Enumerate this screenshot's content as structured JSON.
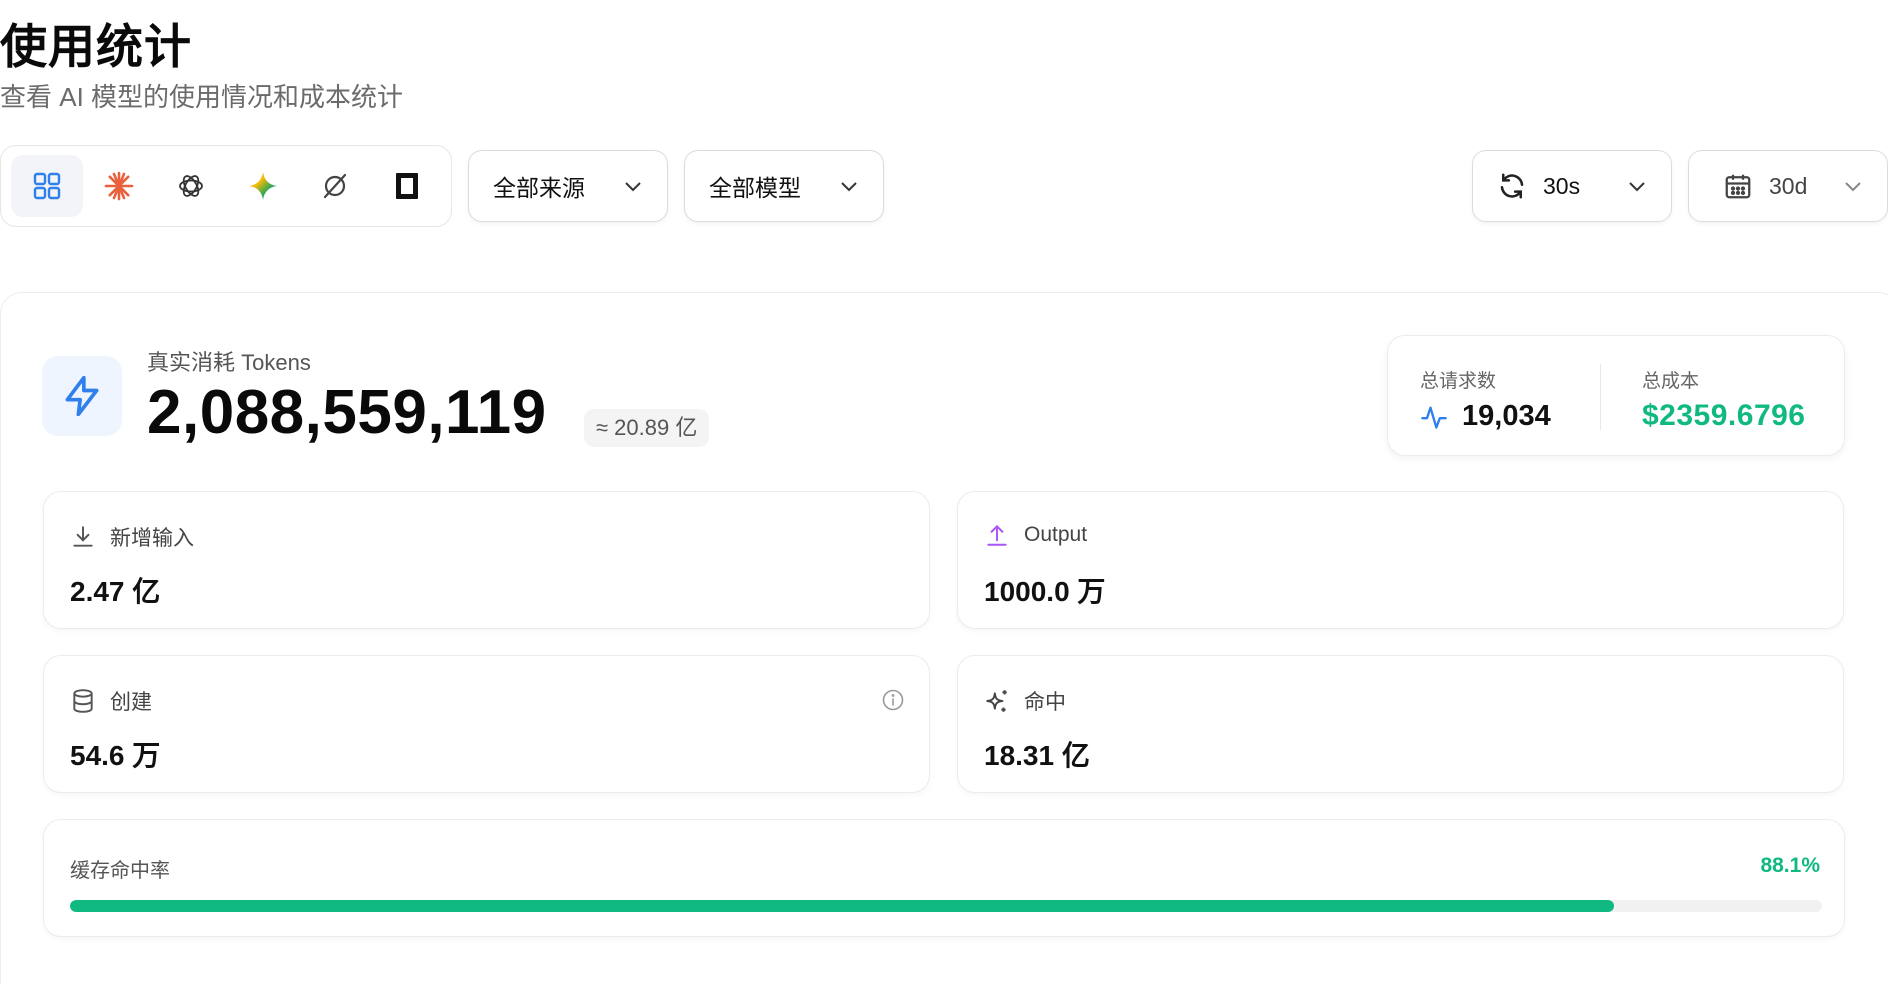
{
  "header": {
    "title": "使用统计",
    "subtitle": "查看 AI 模型的使用情况和成本统计"
  },
  "providers": [
    {
      "icon": "grid-icon",
      "active": true
    },
    {
      "icon": "claude-icon",
      "active": false
    },
    {
      "icon": "openai-icon",
      "active": false
    },
    {
      "icon": "gemini-icon",
      "active": false
    },
    {
      "icon": "model-ring-icon",
      "active": false
    },
    {
      "icon": "square-model-icon",
      "active": false
    }
  ],
  "filters": {
    "source": "全部来源",
    "model": "全部模型",
    "refresh": "30s",
    "range": "30d"
  },
  "tokens": {
    "label": "真实消耗 Tokens",
    "value": "2,088,559,119",
    "approx": "≈ 20.89 亿"
  },
  "summary": {
    "requests_label": "总请求数",
    "requests_value": "19,034",
    "cost_label": "总成本",
    "cost_value": "$2359.6796"
  },
  "metrics": {
    "input": {
      "label": "新增输入",
      "value": "2.47 亿"
    },
    "output": {
      "label": "Output",
      "value": "1000.0 万"
    },
    "create": {
      "label": "创建",
      "value": "54.6 万"
    },
    "hit": {
      "label": "命中",
      "value": "18.31 亿"
    }
  },
  "cache": {
    "label": "缓存命中率",
    "percent_text": "88.1%",
    "fraction": 0.881
  },
  "colors": {
    "accent_blue": "#2f80ed",
    "success_green": "#10b981",
    "output_purple": "#a855f7",
    "claude_orange": "#e8603c"
  }
}
